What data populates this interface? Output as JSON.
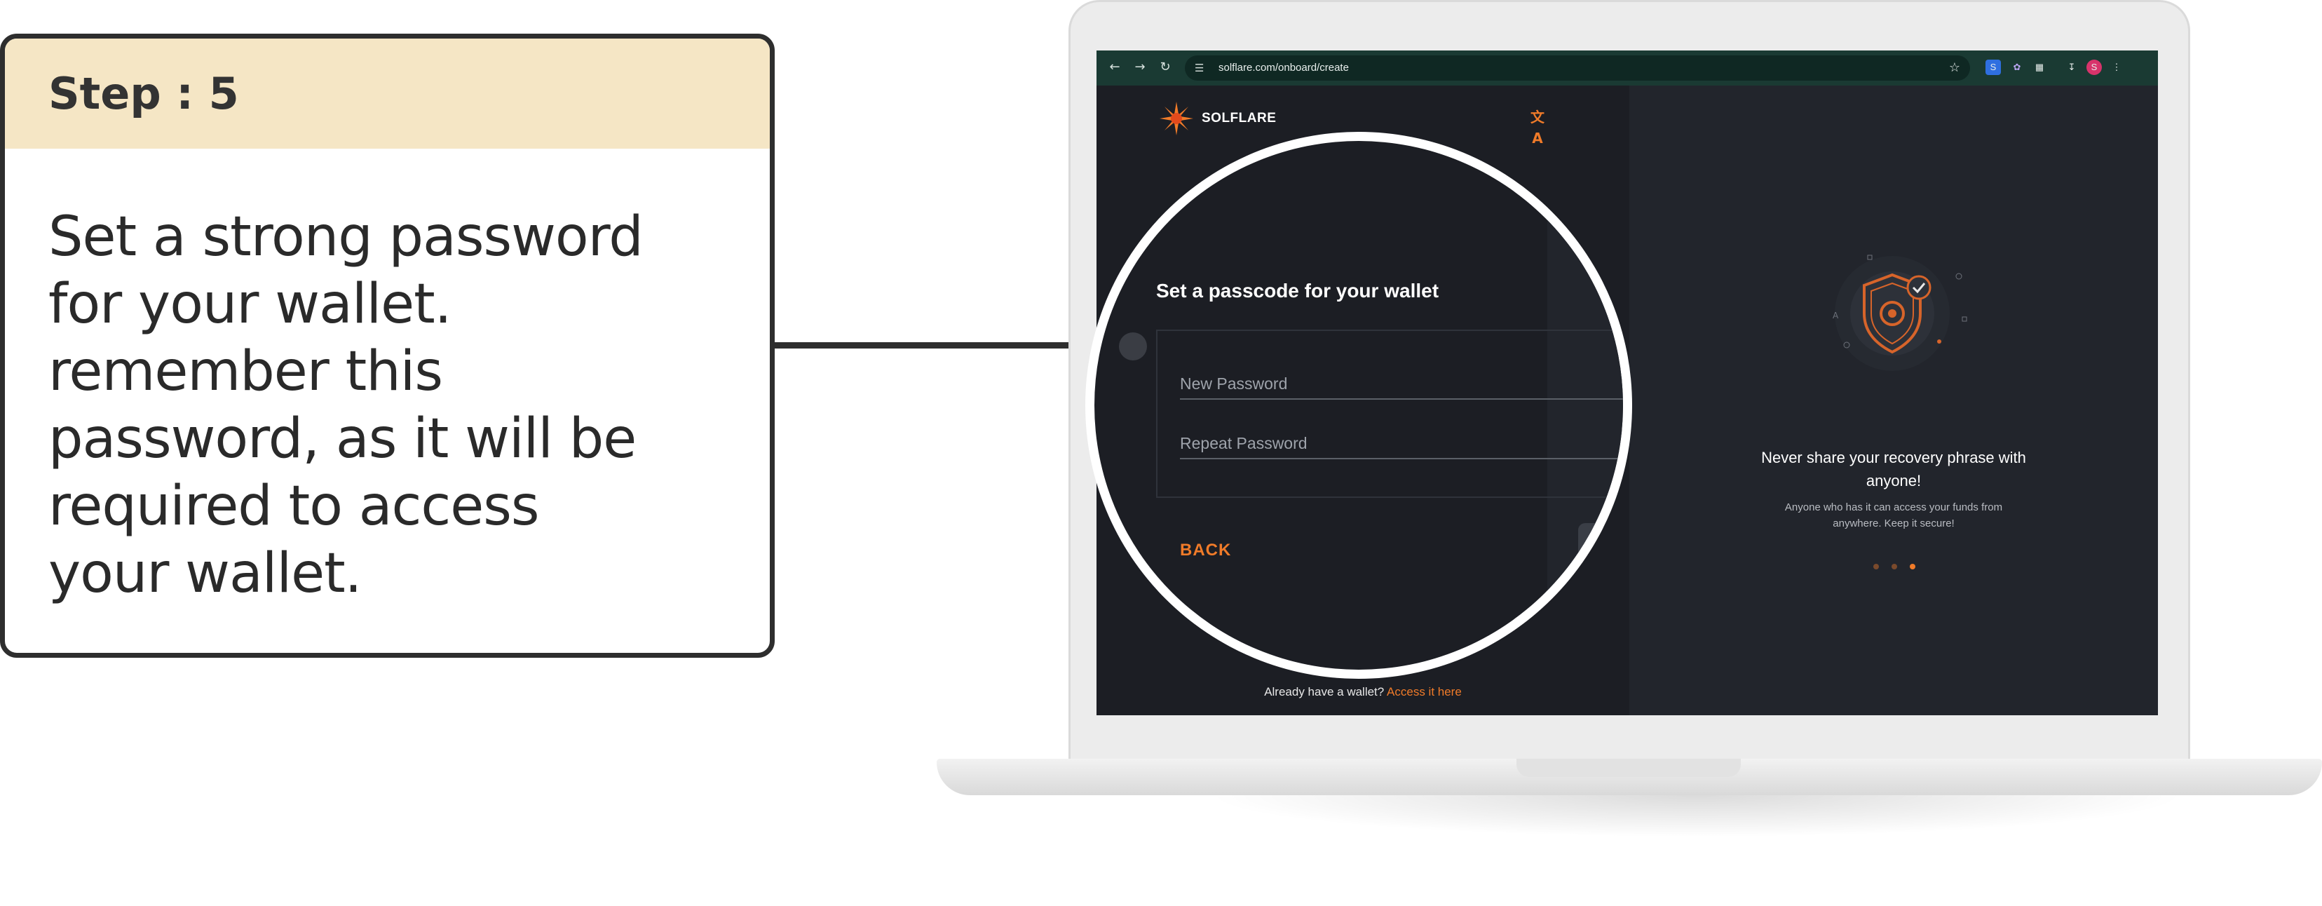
{
  "step_card": {
    "title": "Step : 5",
    "body": "Set a strong password for your wallet. remember this password, as it will be required to access your wallet."
  },
  "browser": {
    "url": "solflare.com/onboard/create",
    "profile_initial": "S"
  },
  "app": {
    "brand": "SOLFLARE",
    "already_text": "Already have a wallet?",
    "access_link": "Access it here",
    "accent_color": "#f07b29"
  },
  "form": {
    "heading": "Set a passcode for your wallet",
    "new_password_placeholder": "New Password",
    "repeat_password_placeholder": "Repeat Password",
    "back_label": "BACK"
  },
  "right_panel": {
    "warning_title": "Never share your recovery phrase with anyone!",
    "warning_subtitle": "Anyone who has it can access your funds from anywhere. Keep it secure!",
    "carousel": {
      "total": 3,
      "active": 3
    }
  }
}
